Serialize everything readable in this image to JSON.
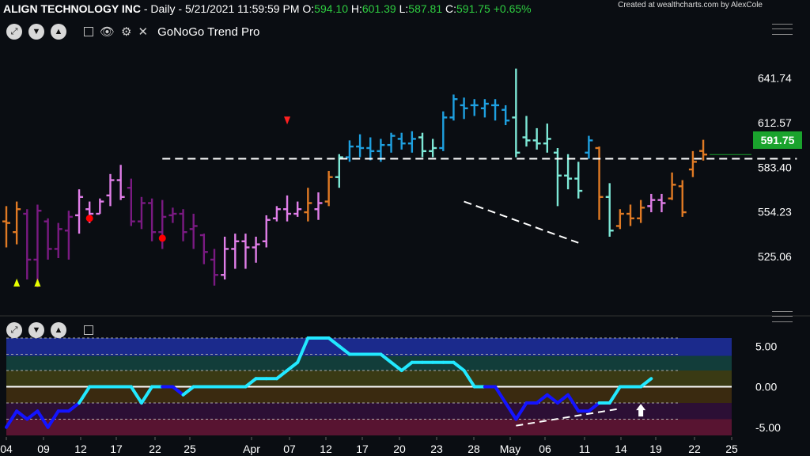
{
  "header": {
    "symbol": "ALIGN TECHNOLOGY INC",
    "meta": " - Daily - 5/21/2021 11:59:59 PM",
    "o_label": " O:",
    "o_val": "594.10",
    "h_label": " H:",
    "h_val": "601.39",
    "l_label": " L:",
    "l_val": "587.81",
    "c_label": " C:",
    "c_val": "591.75",
    "change": "+0.65%",
    "credit": "Created at wealthcharts.com by AlexCole"
  },
  "toolbar": {
    "indicator_name": "GoNoGo Trend Pro"
  },
  "chart_data": [
    {
      "type": "ohlc",
      "x_ticks": [
        "04",
        "09",
        "12",
        "17",
        "22",
        "25",
        "Apr",
        "07",
        "12",
        "17",
        "20",
        "23",
        "28",
        "May",
        "06",
        "11",
        "14",
        "19",
        "22",
        "25"
      ],
      "y_ticks": [
        "641.74",
        "612.57",
        "583.40",
        "554.23",
        "525.06"
      ],
      "ylim": [
        495,
        668
      ],
      "last_price": "591.75",
      "colors": {
        "go_strong": "#1ea0e0",
        "go": "#7de8d6",
        "nogo": "#7a1a82",
        "nogo_weak": "#e07ee8",
        "amber": "#e07a24"
      },
      "bars": [
        {
          "o": 548,
          "h": 558,
          "l": 531,
          "c": 547,
          "t": "amber"
        },
        {
          "o": 541,
          "h": 561,
          "l": 533,
          "c": 556,
          "t": "amber"
        },
        {
          "o": 553,
          "h": 556,
          "l": 510,
          "c": 523,
          "t": "nogo"
        },
        {
          "o": 523,
          "h": 559,
          "l": 505,
          "c": 555,
          "t": "nogo"
        },
        {
          "o": 548,
          "h": 550,
          "l": 523,
          "c": 530,
          "t": "nogo"
        },
        {
          "o": 530,
          "h": 547,
          "l": 524,
          "c": 543,
          "t": "nogo"
        },
        {
          "o": 542,
          "h": 555,
          "l": 523,
          "c": 551,
          "t": "nogo"
        },
        {
          "o": 552,
          "h": 569,
          "l": 540,
          "c": 564,
          "t": "nogo_weak"
        },
        {
          "o": 556,
          "h": 561,
          "l": 547,
          "c": 553,
          "t": "nogo_weak"
        },
        {
          "o": 553,
          "h": 563,
          "l": 553,
          "c": 561,
          "t": "nogo_weak"
        },
        {
          "o": 565,
          "h": 579,
          "l": 558,
          "c": 575,
          "t": "nogo_weak"
        },
        {
          "o": 575,
          "h": 585,
          "l": 562,
          "c": 564,
          "t": "nogo_weak"
        },
        {
          "o": 570,
          "h": 576,
          "l": 545,
          "c": 548,
          "t": "nogo"
        },
        {
          "o": 548,
          "h": 564,
          "l": 543,
          "c": 560,
          "t": "nogo"
        },
        {
          "o": 560,
          "h": 563,
          "l": 535,
          "c": 541,
          "t": "nogo"
        },
        {
          "o": 541,
          "h": 562,
          "l": 530,
          "c": 551,
          "t": "nogo"
        },
        {
          "o": 552,
          "h": 557,
          "l": 547,
          "c": 553,
          "t": "nogo"
        },
        {
          "o": 553,
          "h": 556,
          "l": 535,
          "c": 541,
          "t": "nogo"
        },
        {
          "o": 543,
          "h": 553,
          "l": 530,
          "c": 545,
          "t": "nogo"
        },
        {
          "o": 539,
          "h": 540,
          "l": 520,
          "c": 528,
          "t": "nogo"
        },
        {
          "o": 523,
          "h": 530,
          "l": 506,
          "c": 513,
          "t": "nogo"
        },
        {
          "o": 513,
          "h": 538,
          "l": 510,
          "c": 530,
          "t": "nogo_weak"
        },
        {
          "o": 530,
          "h": 540,
          "l": 517,
          "c": 535,
          "t": "nogo_weak"
        },
        {
          "o": 535,
          "h": 540,
          "l": 517,
          "c": 531,
          "t": "nogo_weak"
        },
        {
          "o": 531,
          "h": 538,
          "l": 521,
          "c": 533,
          "t": "nogo_weak"
        },
        {
          "o": 535,
          "h": 552,
          "l": 531,
          "c": 549,
          "t": "nogo_weak"
        },
        {
          "o": 550,
          "h": 558,
          "l": 548,
          "c": 556,
          "t": "nogo_weak"
        },
        {
          "o": 556,
          "h": 565,
          "l": 548,
          "c": 553,
          "t": "nogo_weak"
        },
        {
          "o": 553,
          "h": 561,
          "l": 551,
          "c": 556,
          "t": "nogo_weak"
        },
        {
          "o": 554,
          "h": 570,
          "l": 548,
          "c": 560,
          "t": "amber"
        },
        {
          "o": 556,
          "h": 567,
          "l": 549,
          "c": 560,
          "t": "nogo_weak"
        },
        {
          "o": 561,
          "h": 581,
          "l": 558,
          "c": 577,
          "t": "amber"
        },
        {
          "o": 577,
          "h": 592,
          "l": 570,
          "c": 590,
          "t": "go"
        },
        {
          "o": 590,
          "h": 601,
          "l": 587,
          "c": 597,
          "t": "go_strong"
        },
        {
          "o": 597,
          "h": 605,
          "l": 590,
          "c": 596,
          "t": "go_strong"
        },
        {
          "o": 596,
          "h": 603,
          "l": 588,
          "c": 594,
          "t": "go_strong"
        },
        {
          "o": 594,
          "h": 602,
          "l": 587,
          "c": 598,
          "t": "go_strong"
        },
        {
          "o": 598,
          "h": 606,
          "l": 593,
          "c": 604,
          "t": "go_strong"
        },
        {
          "o": 602,
          "h": 606,
          "l": 595,
          "c": 599,
          "t": "go_strong"
        },
        {
          "o": 599,
          "h": 607,
          "l": 593,
          "c": 602,
          "t": "go_strong"
        },
        {
          "o": 603,
          "h": 606,
          "l": 590,
          "c": 594,
          "t": "go"
        },
        {
          "o": 594,
          "h": 602,
          "l": 590,
          "c": 596,
          "t": "go"
        },
        {
          "o": 596,
          "h": 620,
          "l": 594,
          "c": 616,
          "t": "go_strong"
        },
        {
          "o": 616,
          "h": 631,
          "l": 614,
          "c": 628,
          "t": "go_strong"
        },
        {
          "o": 624,
          "h": 629,
          "l": 615,
          "c": 622,
          "t": "go_strong"
        },
        {
          "o": 624,
          "h": 628,
          "l": 617,
          "c": 624,
          "t": "go_strong"
        },
        {
          "o": 622,
          "h": 628,
          "l": 616,
          "c": 625,
          "t": "go_strong"
        },
        {
          "o": 624,
          "h": 628,
          "l": 614,
          "c": 624,
          "t": "go_strong"
        },
        {
          "o": 621,
          "h": 624,
          "l": 611,
          "c": 614,
          "t": "go_strong"
        },
        {
          "o": 616,
          "h": 648,
          "l": 590,
          "c": 593,
          "t": "go"
        },
        {
          "o": 603,
          "h": 617,
          "l": 597,
          "c": 601,
          "t": "go"
        },
        {
          "o": 601,
          "h": 609,
          "l": 595,
          "c": 599,
          "t": "go"
        },
        {
          "o": 599,
          "h": 612,
          "l": 593,
          "c": 602,
          "t": "go"
        },
        {
          "o": 593,
          "h": 596,
          "l": 558,
          "c": 578,
          "t": "go"
        },
        {
          "o": 578,
          "h": 592,
          "l": 569,
          "c": 576,
          "t": "go"
        },
        {
          "o": 576,
          "h": 587,
          "l": 563,
          "c": 568,
          "t": "go"
        },
        {
          "o": 593,
          "h": 604,
          "l": 589,
          "c": 601,
          "t": "go_strong"
        },
        {
          "o": 596,
          "h": 597,
          "l": 549,
          "c": 564,
          "t": "amber"
        },
        {
          "o": 564,
          "h": 573,
          "l": 538,
          "c": 542,
          "t": "go"
        },
        {
          "o": 545,
          "h": 556,
          "l": 543,
          "c": 553,
          "t": "amber"
        },
        {
          "o": 553,
          "h": 559,
          "l": 545,
          "c": 550,
          "t": "amber"
        },
        {
          "o": 550,
          "h": 562,
          "l": 547,
          "c": 557,
          "t": "amber"
        },
        {
          "o": 558,
          "h": 566,
          "l": 554,
          "c": 562,
          "t": "nogo_weak"
        },
        {
          "o": 562,
          "h": 566,
          "l": 554,
          "c": 560,
          "t": "nogo_weak"
        },
        {
          "o": 563,
          "h": 580,
          "l": 562,
          "c": 572,
          "t": "amber"
        },
        {
          "o": 571,
          "h": 575,
          "l": 551,
          "c": 554,
          "t": "amber"
        },
        {
          "o": 582,
          "h": 594,
          "l": 577,
          "c": 587,
          "t": "amber"
        },
        {
          "o": 594.1,
          "h": 601.39,
          "l": 587.81,
          "c": 591.75,
          "t": "amber"
        }
      ],
      "markers": [
        {
          "bar": 8,
          "price": 550,
          "kind": "dot",
          "color": "#ff0000"
        },
        {
          "bar": 15,
          "price": 537,
          "kind": "dot",
          "color": "#ff0000"
        },
        {
          "bar": 1,
          "price": 508,
          "kind": "up",
          "color": "#e8ff00"
        },
        {
          "bar": 3,
          "price": 508,
          "kind": "up",
          "color": "#e8ff00"
        },
        {
          "bar": 27,
          "price": 614,
          "kind": "down",
          "color": "#ff2020"
        }
      ],
      "lines": [
        {
          "x1": 15,
          "y1": 589,
          "x2": 76,
          "y2": 589,
          "color": "#ffffff"
        },
        {
          "x1": 44,
          "y1": 561,
          "x2": 55,
          "y2": 534,
          "color": "#ffffff"
        }
      ]
    },
    {
      "type": "line",
      "y_ticks": [
        "5.00",
        "0.00",
        "-5.00"
      ],
      "ylim": [
        -6,
        6
      ],
      "x_ticks": [
        "04",
        "09",
        "12",
        "17",
        "22",
        "25",
        "Apr",
        "07",
        "12",
        "17",
        "20",
        "23",
        "28",
        "May",
        "06",
        "11",
        "14",
        "19",
        "22",
        "25"
      ],
      "series": [
        {
          "values": [
            -5,
            -3,
            -4,
            -3,
            -5,
            -3,
            -3,
            -2,
            0,
            0,
            0,
            0,
            0,
            -2,
            0,
            0,
            0,
            -1,
            0,
            0,
            0,
            0,
            0,
            0,
            1,
            1,
            1,
            2,
            3,
            6,
            6,
            6,
            5,
            4,
            4,
            4,
            4,
            3,
            2,
            3,
            3,
            3,
            3,
            3,
            2,
            0,
            0,
            0,
            -2,
            -4,
            -2,
            -2,
            -1,
            -2,
            -1,
            -3,
            -3,
            -2,
            -2,
            0,
            0,
            0,
            1
          ]
        }
      ],
      "point_colors": [
        "blue",
        "blue",
        "blue",
        "blue",
        "blue",
        "blue",
        "blue",
        "blue",
        "cyan",
        "cyan",
        "cyan",
        "cyan",
        "cyan",
        "cyan",
        "cyan",
        "cyan",
        "blue",
        "blue",
        "cyan",
        "cyan",
        "cyan",
        "cyan",
        "cyan",
        "cyan",
        "cyan",
        "cyan",
        "cyan",
        "cyan",
        "cyan",
        "cyan",
        "cyan",
        "cyan",
        "cyan",
        "cyan",
        "cyan",
        "cyan",
        "cyan",
        "cyan",
        "cyan",
        "cyan",
        "cyan",
        "cyan",
        "cyan",
        "cyan",
        "cyan",
        "cyan",
        "cyan",
        "blue",
        "blue",
        "blue",
        "blue",
        "blue",
        "blue",
        "blue",
        "blue",
        "blue",
        "blue",
        "blue",
        "cyan",
        "cyan",
        "cyan",
        "cyan",
        "cyan"
      ],
      "bands": [
        {
          "from": 6,
          "to": 3.8,
          "color": "#1b2a8c"
        },
        {
          "from": 3.8,
          "to": 2,
          "color": "#123d3a"
        },
        {
          "from": 2,
          "to": 0,
          "color": "#3a3a14"
        },
        {
          "from": 0,
          "to": -2,
          "color": "#3a2a10"
        },
        {
          "from": -2,
          "to": -4,
          "color": "#2c0f35"
        },
        {
          "from": -4,
          "to": -6,
          "color": "#581431"
        }
      ],
      "dashed_levels": [
        6,
        4,
        2,
        -2,
        -4
      ],
      "trendline": {
        "x1": 49,
        "y1": -4.8,
        "x2": 59,
        "y2": -2.7
      },
      "arrow": {
        "x": 61,
        "y": -2.7
      }
    }
  ]
}
